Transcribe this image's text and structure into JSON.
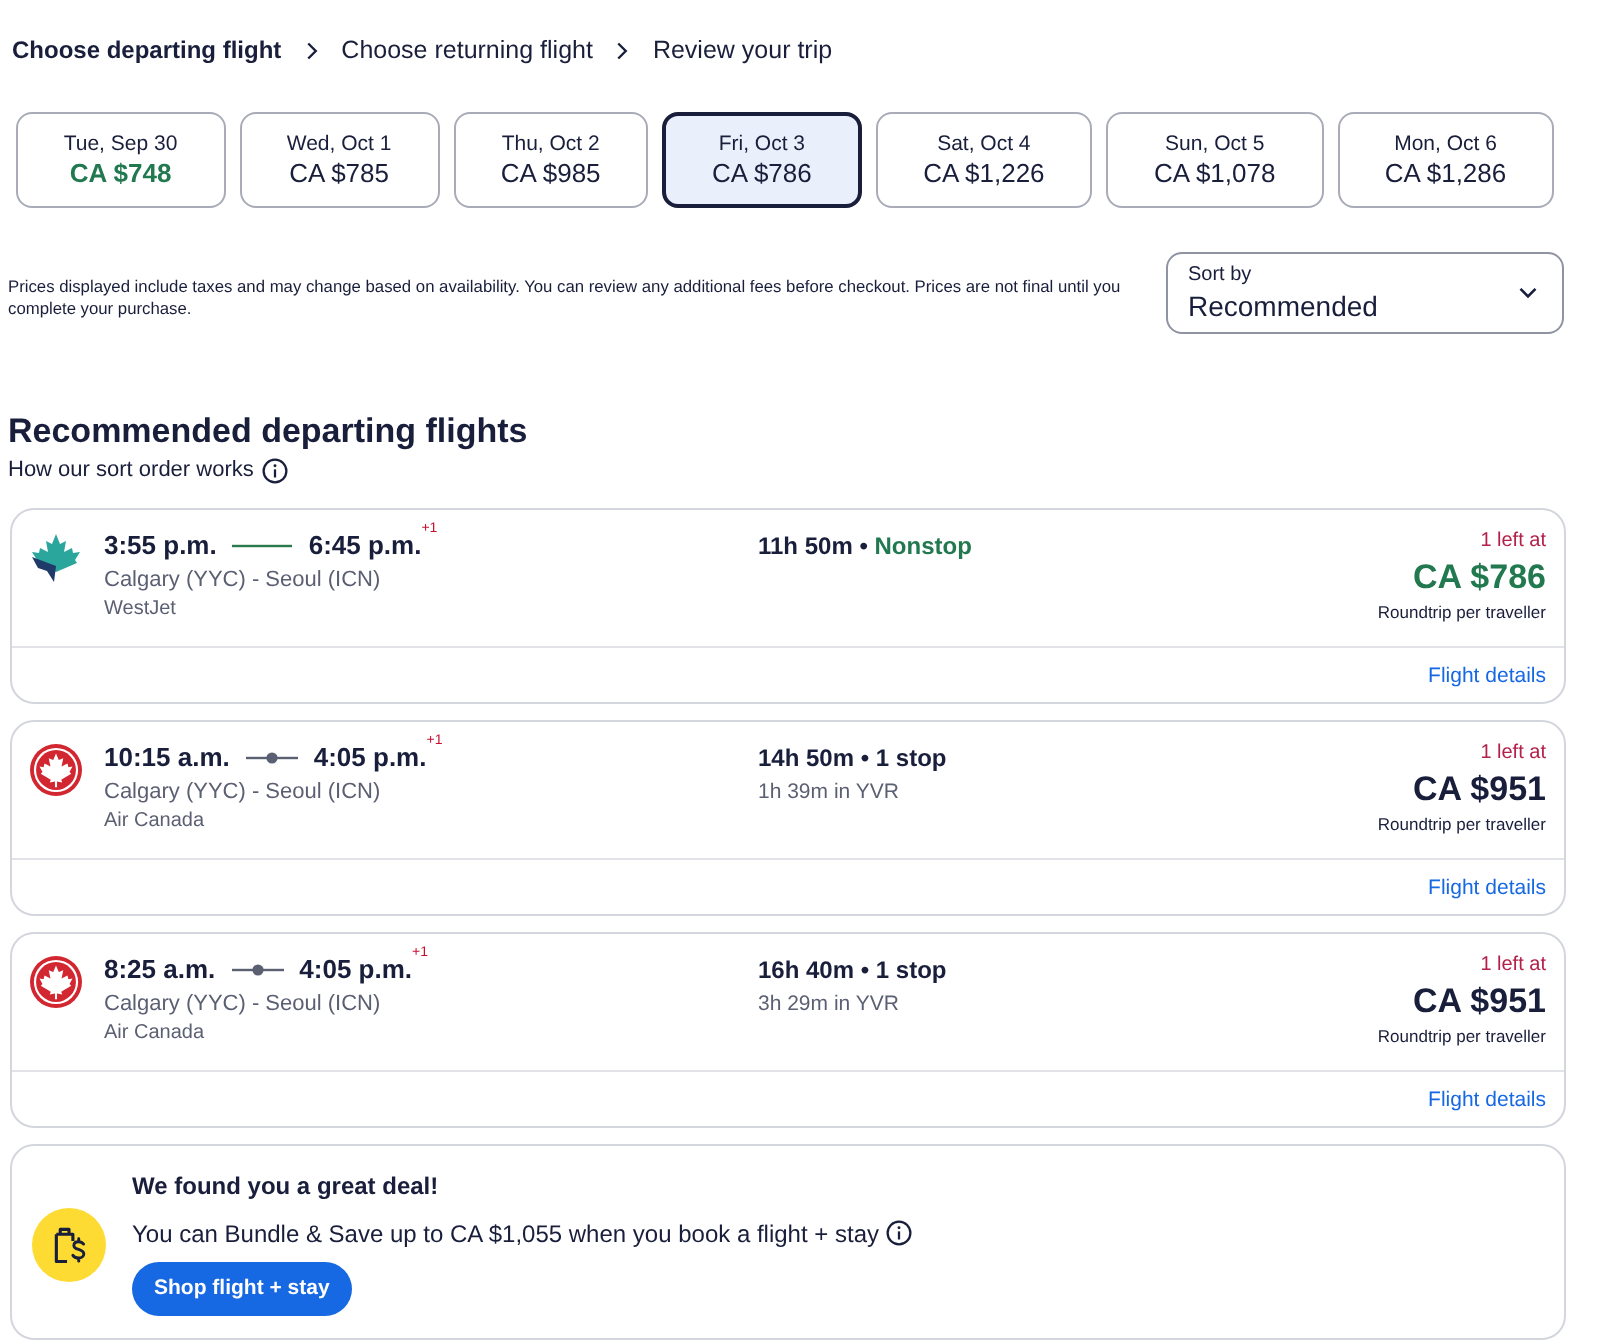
{
  "breadcrumb": [
    {
      "label": "Choose departing flight",
      "selected": true
    },
    {
      "label": "Choose returning flight",
      "selected": false
    },
    {
      "label": "Review your trip",
      "selected": false
    }
  ],
  "dates": [
    {
      "date": "Tue, Sep 30",
      "price": "CA $748",
      "selected": false,
      "cheapest": true
    },
    {
      "date": "Wed, Oct 1",
      "price": "CA $785",
      "selected": false,
      "cheapest": false
    },
    {
      "date": "Thu, Oct 2",
      "price": "CA $985",
      "selected": false,
      "cheapest": false
    },
    {
      "date": "Fri, Oct 3",
      "price": "CA $786",
      "selected": true,
      "cheapest": false
    },
    {
      "date": "Sat, Oct 4",
      "price": "CA $1,226",
      "selected": false,
      "cheapest": false
    },
    {
      "date": "Sun, Oct 5",
      "price": "CA $1,078",
      "selected": false,
      "cheapest": false
    },
    {
      "date": "Mon, Oct 6",
      "price": "CA $1,286",
      "selected": false,
      "cheapest": false
    }
  ],
  "disclaimer": "Prices displayed include taxes and may change based on availability. You can review any additional fees before checkout. Prices are not final until you complete your purchase.",
  "sort": {
    "label": "Sort by",
    "value": "Recommended"
  },
  "results": {
    "title": "Recommended departing flights",
    "sort_info_link": "How our sort order works"
  },
  "flights": [
    {
      "kind": "leaf",
      "depart": "3:55 p.m.",
      "arrive": "6:45 p.m.",
      "day_offset": "+1",
      "route": "Calgary (YYC) - Seoul (ICN)",
      "airline": "WestJet",
      "duration": "11h 50m",
      "separator": "•",
      "stops": "Nonstop",
      "nonstop": true,
      "availability": "1 left at",
      "price": "CA $786",
      "price_highlighted": true,
      "price_note": "Roundtrip per traveller",
      "details_link": "Flight details"
    },
    {
      "kind": "roundel",
      "depart": "10:15 a.m.",
      "arrive": "4:05 p.m.",
      "day_offset": "+1",
      "route": "Calgary (YYC) - Seoul (ICN)",
      "airline": "Air Canada",
      "duration": "14h 50m",
      "separator": "•",
      "stops": "1 stop",
      "nonstop": false,
      "layover": "1h 39m in YVR",
      "availability": "1 left at",
      "price": "CA $951",
      "price_highlighted": false,
      "price_note": "Roundtrip per traveller",
      "details_link": "Flight details"
    },
    {
      "kind": "roundel",
      "depart": "8:25 a.m.",
      "arrive": "4:05 p.m.",
      "day_offset": "+1",
      "route": "Calgary (YYC) - Seoul (ICN)",
      "airline": "Air Canada",
      "duration": "16h 40m",
      "separator": "•",
      "stops": "1 stop",
      "nonstop": false,
      "layover": "3h 29m in YVR",
      "availability": "1 left at",
      "price": "CA $951",
      "price_highlighted": false,
      "price_note": "Roundtrip per traveller",
      "details_link": "Flight details"
    }
  ],
  "deal": {
    "title": "We found you a great deal!",
    "text": "You can Bundle & Save up to CA $1,055 when you book a flight + stay",
    "button": "Shop flight + stay"
  }
}
